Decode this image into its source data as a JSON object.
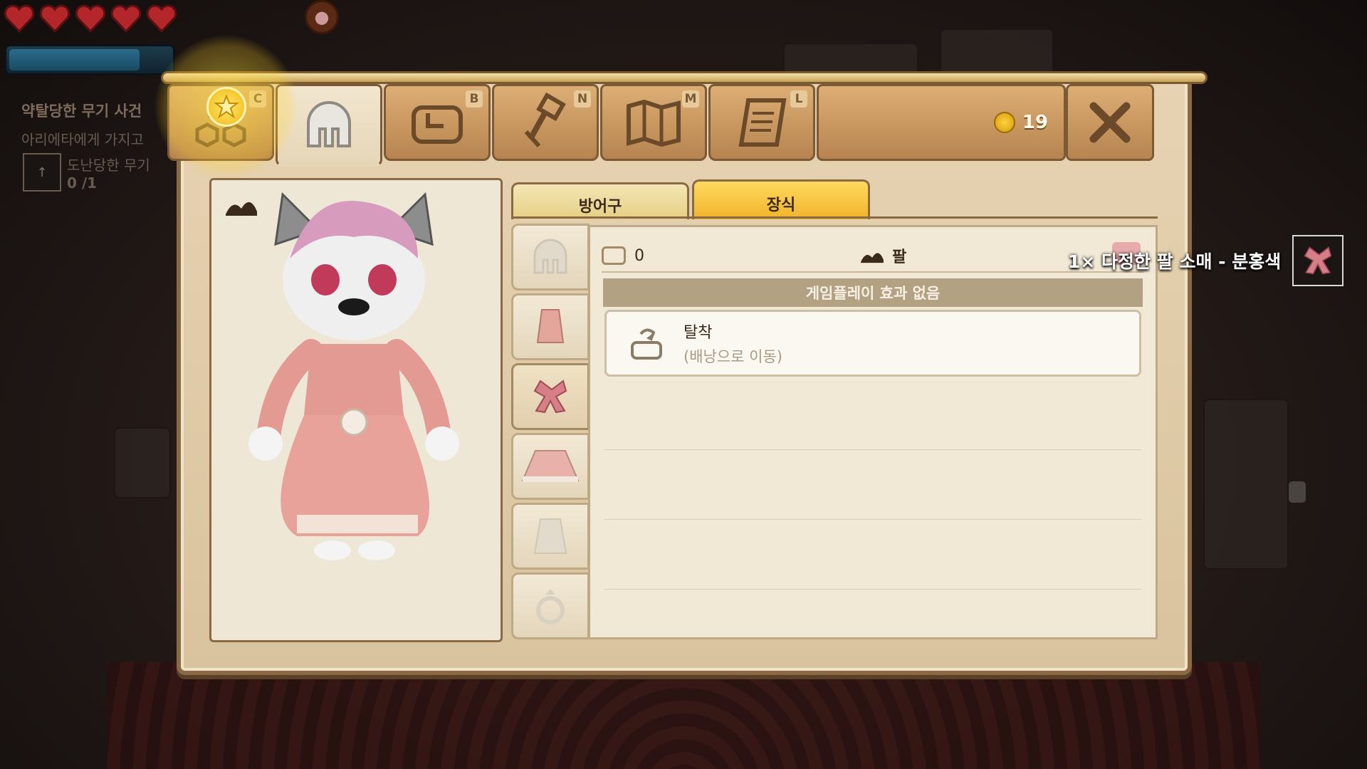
{
  "hud": {
    "hearts": 5,
    "mana_fill": 0.78
  },
  "quest": {
    "title": "약탈당한 무기 사건",
    "subtitle": "아리에타에게 가지고",
    "item_name": "도난당한 무기",
    "item_count": "0 /1"
  },
  "tabs": [
    {
      "icon": "party-icon",
      "key": "C"
    },
    {
      "icon": "helmet-icon",
      "key": ""
    },
    {
      "icon": "bag-icon",
      "key": "B"
    },
    {
      "icon": "crafting-hammer-icon",
      "key": "N"
    },
    {
      "icon": "map-icon",
      "key": "M"
    },
    {
      "icon": "scroll-icon",
      "key": "L"
    }
  ],
  "currency": {
    "amount": "19"
  },
  "sub_tabs": {
    "armor": "방어구",
    "decoration": "장식"
  },
  "detail": {
    "bag_count": "0",
    "slot_name": "팔",
    "effect": "게임플레이 효과 없음",
    "unequip_label": "탈착",
    "unequip_hint": "(배낭으로 이동)"
  },
  "notification": {
    "text": "1× 다정한 팔 소매 - 분홍색"
  },
  "colors": {
    "frame": "#d9c39e",
    "tab": "#c99660",
    "active_subtab": "#f1b42c",
    "effect_bar": "#b3a184"
  }
}
